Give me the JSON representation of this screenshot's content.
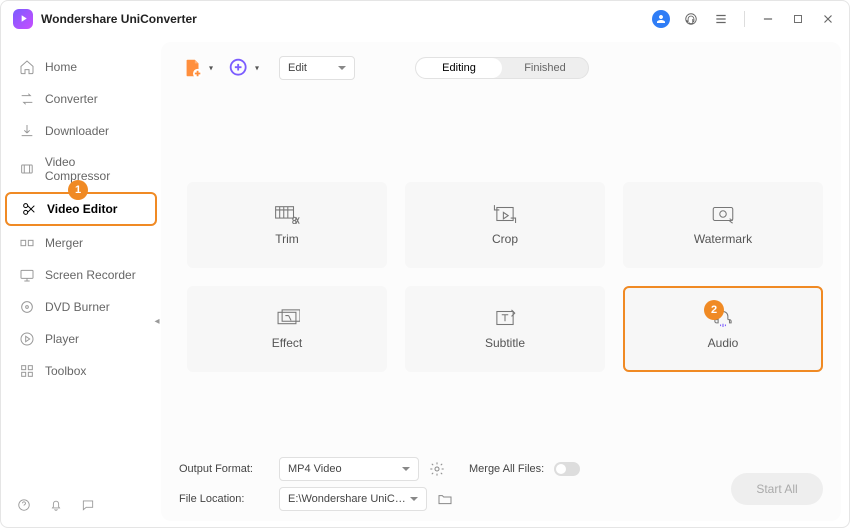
{
  "app": {
    "title": "Wondershare UniConverter"
  },
  "sidebar": {
    "items": [
      {
        "label": "Home"
      },
      {
        "label": "Converter"
      },
      {
        "label": "Downloader"
      },
      {
        "label": "Video Compressor"
      },
      {
        "label": "Video Editor",
        "selected": true
      },
      {
        "label": "Merger"
      },
      {
        "label": "Screen Recorder"
      },
      {
        "label": "DVD Burner"
      },
      {
        "label": "Player"
      },
      {
        "label": "Toolbox"
      }
    ]
  },
  "toolbar": {
    "mode_dropdown": "Edit"
  },
  "tabs": {
    "editing": "Editing",
    "finished": "Finished"
  },
  "tiles": {
    "trim": "Trim",
    "crop": "Crop",
    "watermark": "Watermark",
    "effect": "Effect",
    "subtitle": "Subtitle",
    "audio": "Audio"
  },
  "bottom": {
    "output_label": "Output Format:",
    "output_value": "MP4 Video",
    "location_label": "File Location:",
    "location_value": "E:\\Wondershare UniConverter",
    "merge_label": "Merge All Files:",
    "start_all": "Start All"
  },
  "badges": {
    "one": "1",
    "two": "2"
  }
}
